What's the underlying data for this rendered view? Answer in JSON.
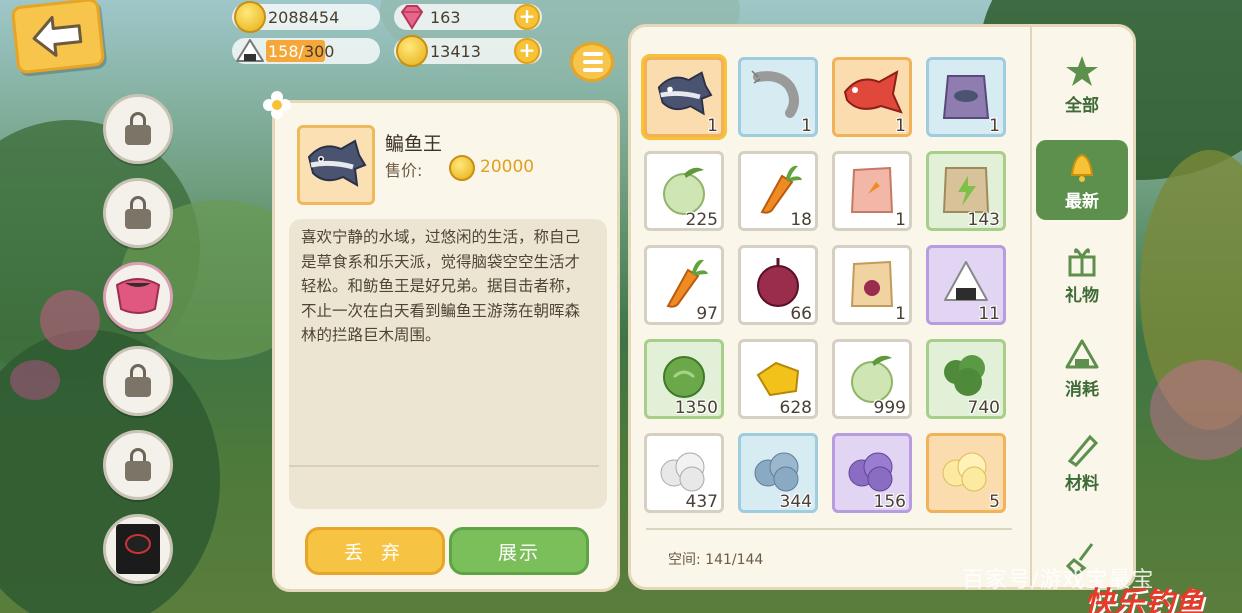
{
  "currency": {
    "coins": "2088454",
    "gems": "163",
    "stamina_current": "158",
    "stamina_sep": "/",
    "stamina_max": "300",
    "stamina_fraction": 0.527,
    "gold_ingot": "13413"
  },
  "detail": {
    "name": "鳊鱼王",
    "price_label": "售价:",
    "price_value": "20000",
    "description": "喜欢宁静的水域，过悠闲的生活，称自己是草食系和乐天派，觉得脑袋空空生活才轻松。和鲂鱼王是好兄弟。据目击者称，不止一次在白天看到鳊鱼王游荡在朝晖森林的拦路巨木周围。",
    "discard_label": "丢 弃",
    "show_label": "展示"
  },
  "inventory": {
    "space_label": "空间:",
    "space_value": "141/144",
    "items": [
      {
        "icon": "bream-fish-icon",
        "rarity": "orange",
        "qty": "1",
        "selected": true
      },
      {
        "icon": "shrimp-icon",
        "rarity": "blue",
        "qty": "1"
      },
      {
        "icon": "red-fish-icon",
        "rarity": "orange",
        "qty": "1"
      },
      {
        "icon": "fish-bag-icon",
        "rarity": "blue",
        "qty": "1"
      },
      {
        "icon": "melon-icon",
        "rarity": "white",
        "qty": "225"
      },
      {
        "icon": "carrot-icon",
        "rarity": "white",
        "qty": "18"
      },
      {
        "icon": "carrot-seed-bag-icon",
        "rarity": "white",
        "qty": "1"
      },
      {
        "icon": "fertilizer-bag-icon",
        "rarity": "green",
        "qty": "143"
      },
      {
        "icon": "carrot-icon",
        "rarity": "white",
        "qty": "97"
      },
      {
        "icon": "onion-icon",
        "rarity": "white",
        "qty": "66"
      },
      {
        "icon": "onion-seed-bag-icon",
        "rarity": "white",
        "qty": "1"
      },
      {
        "icon": "rice-ball-icon",
        "rarity": "purple",
        "qty": "11"
      },
      {
        "icon": "cabbage-icon",
        "rarity": "green",
        "qty": "1350"
      },
      {
        "icon": "gold-ore-icon",
        "rarity": "white",
        "qty": "628"
      },
      {
        "icon": "melon-icon",
        "rarity": "white",
        "qty": "999"
      },
      {
        "icon": "broccoli-icon",
        "rarity": "green",
        "qty": "740"
      },
      {
        "icon": "white-wool-icon",
        "rarity": "white",
        "qty": "437"
      },
      {
        "icon": "blue-wool-icon",
        "rarity": "blue",
        "qty": "344"
      },
      {
        "icon": "purple-wool-icon",
        "rarity": "purple",
        "qty": "156"
      },
      {
        "icon": "yellow-wool-icon",
        "rarity": "orange",
        "qty": "5"
      }
    ]
  },
  "tabs": [
    {
      "label": "全部",
      "icon": "star-icon",
      "active": false
    },
    {
      "label": "最新",
      "icon": "bell-icon",
      "active": true
    },
    {
      "label": "礼物",
      "icon": "gift-icon",
      "active": false
    },
    {
      "label": "消耗",
      "icon": "rice-ball-icon",
      "active": false
    },
    {
      "label": "材料",
      "icon": "wood-log-icon",
      "active": false
    },
    {
      "label": "",
      "icon": "shovel-icon",
      "active": false
    }
  ],
  "watermark": {
    "source": "百家号/游戏宝最宝",
    "brand": "快乐钓鱼"
  },
  "colors": {
    "accent_yellow": "#f6c236",
    "accent_green": "#5d8f4d",
    "coin_text": "#e0a020",
    "stamina_fill": "#f5a73a"
  }
}
